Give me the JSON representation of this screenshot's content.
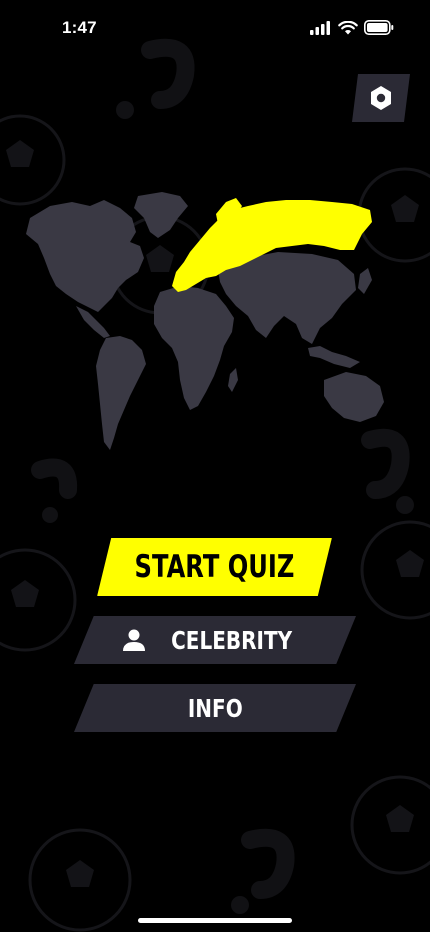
{
  "status_bar": {
    "time": "1:47",
    "icons": [
      "cellular-signal-icon",
      "wifi-icon",
      "battery-icon"
    ]
  },
  "header": {
    "settings_icon": "hexagon-settings-icon"
  },
  "map": {
    "highlighted_region": "Europe",
    "highlight_color": "#ffff00",
    "land_color": "#3a3944"
  },
  "menu": {
    "start_quiz_label": "START QUIZ",
    "celebrity_label": "CELEBRITY",
    "celebrity_icon": "person-icon",
    "info_label": "INFO"
  },
  "colors": {
    "background": "#000000",
    "accent": "#ffff00",
    "button_dark": "#2b2a35"
  }
}
